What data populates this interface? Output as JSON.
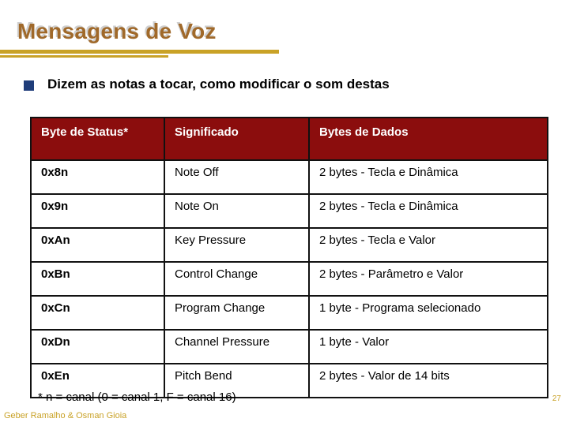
{
  "slide": {
    "title": "Mensagens de Voz",
    "page_number": "27",
    "attribution": "Geber Ramalho & Osman Gioia",
    "footnote": "* n = canal (0 = canal 1, F = canal 16)",
    "colors": {
      "title": "#A0692A",
      "title_shadow": "#cfcfcf",
      "rule": "#C9A227",
      "bullet": "#1F3D7A",
      "table_header_bg": "#8B0D0D",
      "table_header_text": "#ffffff",
      "table_border": "#111111",
      "accent_gold": "#C9A227"
    }
  },
  "bullet": {
    "marker": "square-bullet",
    "text": "Dizem as notas a tocar, como modificar o som destas"
  },
  "table": {
    "headers": [
      "Byte de Status*",
      "Significado",
      "Bytes de Dados"
    ],
    "rows": [
      {
        "status": "0x8n",
        "meaning": "Note Off",
        "data": "2 bytes - Tecla e Dinâmica"
      },
      {
        "status": "0x9n",
        "meaning": "Note On",
        "data": "2 bytes - Tecla e Dinâmica"
      },
      {
        "status": "0xAn",
        "meaning": "Key Pressure",
        "data": "2 bytes - Tecla e Valor"
      },
      {
        "status": "0xBn",
        "meaning": "Control Change",
        "data": "2 bytes - Parâmetro e Valor"
      },
      {
        "status": "0xCn",
        "meaning": "Program Change",
        "data": "1 byte   - Programa selecionado"
      },
      {
        "status": "0xDn",
        "meaning": "Channel Pressure",
        "data": "1 byte   - Valor"
      },
      {
        "status": "0xEn",
        "meaning": "Pitch Bend",
        "data": "2 bytes - Valor de 14 bits"
      }
    ]
  }
}
